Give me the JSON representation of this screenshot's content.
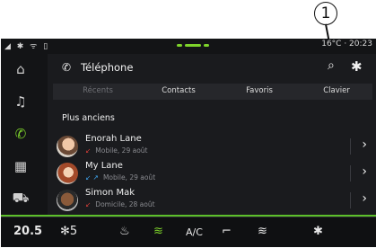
{
  "callout": {
    "number": "1"
  },
  "statusbar": {
    "left": "◢ ✱ ᯤ ▯",
    "right": "16°C · 20:23"
  },
  "sidebar": {
    "items": [
      {
        "icon": "home-icon",
        "glyph": "⌂"
      },
      {
        "icon": "music-icon",
        "glyph": "♫"
      },
      {
        "icon": "phone-icon",
        "glyph": "✆"
      },
      {
        "icon": "apps-icon",
        "glyph": "▦"
      },
      {
        "icon": "car-icon",
        "glyph": "⛟"
      }
    ]
  },
  "header": {
    "title": "Téléphone",
    "phone_glyph": "✆",
    "search_glyph": "⌕",
    "gear_glyph": "✱"
  },
  "tabs": [
    "Récents",
    "Contacts",
    "Favoris",
    "Clavier"
  ],
  "section_title": "Plus anciens",
  "contacts": [
    {
      "name": "Enorah Lane",
      "detail": "Mobile, 29 août",
      "call_glyph": "↙",
      "call_color": "#e0403a"
    },
    {
      "name": "My Lane",
      "detail": "Mobile, 29 août",
      "call_glyph": "↙ ↗",
      "call_color": "#3fa9f5"
    },
    {
      "name": "Simon Mak",
      "detail": "Domicile, 28 août",
      "call_glyph": "↙",
      "call_color": "#e0403a"
    }
  ],
  "chevron": "›",
  "bottombar": {
    "left_temp": "20.5",
    "fan": "5",
    "items": [
      "♨",
      "≋",
      "A/C",
      "⌐",
      "≋",
      "✱"
    ]
  },
  "colors": {
    "accent": "#7ed42b",
    "background": "#131416"
  }
}
